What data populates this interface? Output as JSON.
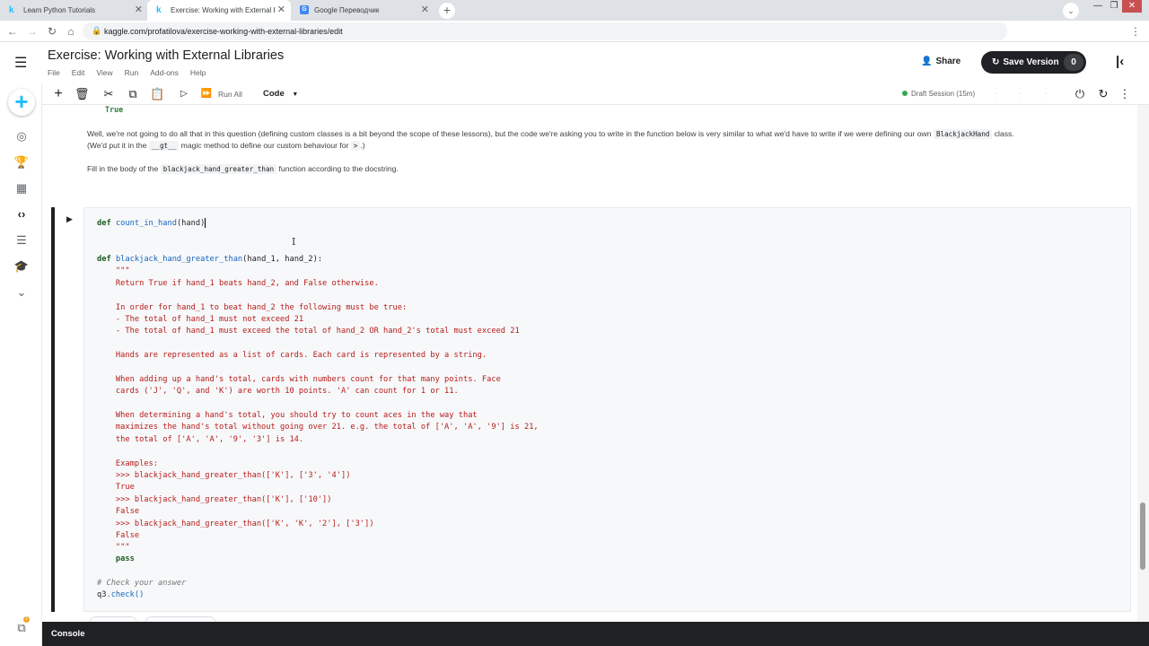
{
  "browser": {
    "tabs": [
      {
        "favicon": "k",
        "title": "Learn Python Tutorials",
        "close": "✕"
      },
      {
        "favicon": "k",
        "title": "Exercise: Working with External Libra…",
        "close": "✕"
      },
      {
        "favicon": "G",
        "title": "Google Переводчик",
        "close": "✕"
      }
    ],
    "new_tab": "+",
    "url": "kaggle.com/profatilova/exercise-working-with-external-libraries/edit"
  },
  "header": {
    "title": "Exercise: Working with External Libraries",
    "menus": [
      "File",
      "Edit",
      "View",
      "Run",
      "Add-ons",
      "Help"
    ],
    "share_label": "Share",
    "save_version_label": "Save Version",
    "save_version_count": "0"
  },
  "toolbar": {
    "run_all_label": "Run All",
    "cell_type": "Code",
    "session_status": "Draft Session (15m)",
    "status_color": "#34a853"
  },
  "notebook": {
    "prev_output": "True",
    "md_para1_a": "Well, we're not going to do all that in this question (defining custom classes is a bit beyond the scope of these lessons), but the code we're asking you to write in the function below is very similar to what we'd have to write if we were defining our own ",
    "md_para1_code1": "BlackjackHand",
    "md_para1_b": " class.",
    "md_para2_a": "(We'd put it in the ",
    "md_para2_code": "__gt__",
    "md_para2_b": " magic method to define our custom behaviour for ",
    "md_para2_code2": ">",
    "md_para2_c": ".)",
    "md_para3_a": "Fill in the body of the ",
    "md_para3_code": "blackjack_hand_greater_than",
    "md_para3_b": " function according to the docstring.",
    "code": {
      "kw_def": "def",
      "fn1": "count_in_hand",
      "fn1_args": "(hand)",
      "fn2": "blackjack_hand_greater_than",
      "fn2_args": "(hand_1, hand_2):",
      "doc_lines": [
        "    \"\"\"",
        "    Return True if hand_1 beats hand_2, and False otherwise.",
        "",
        "    In order for hand_1 to beat hand_2 the following must be true:",
        "    - The total of hand_1 must not exceed 21",
        "    - The total of hand_1 must exceed the total of hand_2 OR hand_2's total must exceed 21",
        "",
        "    Hands are represented as a list of cards. Each card is represented by a string.",
        "",
        "    When adding up a hand's total, cards with numbers count for that many points. Face",
        "    cards ('J', 'Q', and 'K') are worth 10 points. 'A' can count for 1 or 11.",
        "",
        "    When determining a hand's total, you should try to count aces in the way that",
        "    maximizes the hand's total without going over 21. e.g. the total of ['A', 'A', '9'] is 21,",
        "    the total of ['A', 'A', '9', '3'] is 14.",
        "",
        "    Examples:",
        "    >>> blackjack_hand_greater_than(['K'], ['3', '4'])",
        "    True",
        "    >>> blackjack_hand_greater_than(['K'], ['10'])",
        "    False",
        "    >>> blackjack_hand_greater_than(['K', 'K', '2'], ['3'])",
        "    False",
        "    \"\"\""
      ],
      "pass_line": "    pass",
      "comment": "# Check your answer",
      "check_obj": "q3",
      "check_call": ".check()"
    }
  },
  "console": {
    "label": "Console"
  }
}
